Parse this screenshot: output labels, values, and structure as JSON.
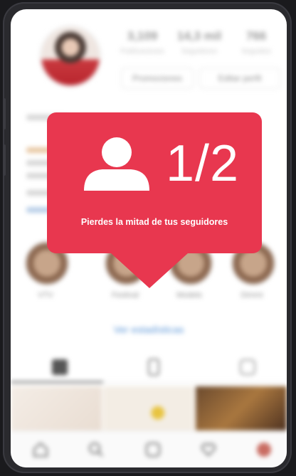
{
  "profile": {
    "stats": [
      {
        "value": "3,109",
        "label": "Publicaciones"
      },
      {
        "value": "14,3 mil",
        "label": "Seguidores"
      },
      {
        "value": "766",
        "label": "Seguidos"
      }
    ],
    "promo_button": "Promociones",
    "edit_button": "Editar perfil"
  },
  "highlights": [
    {
      "label": "VTV"
    },
    {
      "label": "Festival"
    },
    {
      "label": "Modelo"
    },
    {
      "label": "Dimmi"
    }
  ],
  "stats_link": "Ver estadísticas",
  "notification": {
    "ratio": "1/2",
    "caption": "Pierdes la mitad de tus seguidores",
    "icon": "user-icon",
    "color": "#e8374f"
  },
  "nav": {
    "icons": [
      "home-icon",
      "search-icon",
      "reels-icon",
      "heart-icon",
      "profile-icon"
    ]
  }
}
